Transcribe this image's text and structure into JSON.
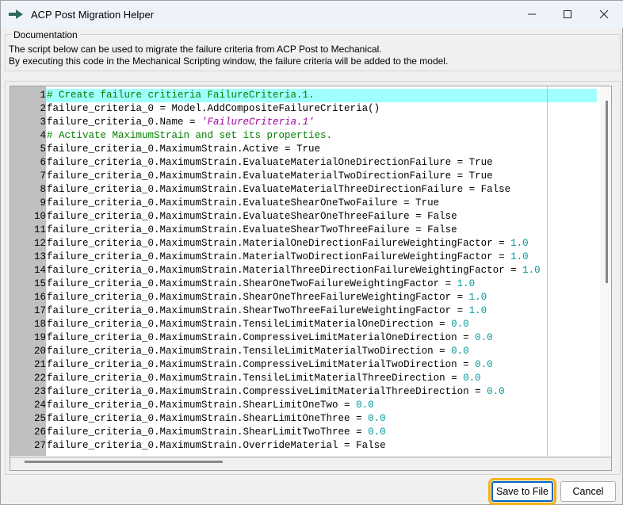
{
  "window": {
    "title": "ACP Post Migration Helper",
    "icon": "arrow-right-icon",
    "controls": [
      "minimize",
      "maximize",
      "close"
    ]
  },
  "documentation": {
    "label": "Documentation",
    "lines": [
      "The script below can be used to migrate the failure criteria from ACP Post to Mechanical.",
      "By executing this code in the Mechanical Scripting window, the failure criteria will be added to the model."
    ]
  },
  "editor": {
    "highlight_color": "#a0ffff",
    "current_line": 1,
    "lines": [
      [
        [
          "c",
          "# Create failure critieria FailureCriteria.1."
        ]
      ],
      [
        [
          "p",
          "failure_criteria_0 = Model.AddCompositeFailureCriteria()"
        ]
      ],
      [
        [
          "p",
          "failure_criteria_0.Name = "
        ],
        [
          "s",
          "'FailureCriteria.1'"
        ]
      ],
      [
        [
          "c",
          "# Activate MaximumStrain and set its properties."
        ]
      ],
      [
        [
          "p",
          "failure_criteria_0.MaximumStrain.Active = True"
        ]
      ],
      [
        [
          "p",
          "failure_criteria_0.MaximumStrain.EvaluateMaterialOneDirectionFailure = True"
        ]
      ],
      [
        [
          "p",
          "failure_criteria_0.MaximumStrain.EvaluateMaterialTwoDirectionFailure = True"
        ]
      ],
      [
        [
          "p",
          "failure_criteria_0.MaximumStrain.EvaluateMaterialThreeDirectionFailure = False"
        ]
      ],
      [
        [
          "p",
          "failure_criteria_0.MaximumStrain.EvaluateShearOneTwoFailure = True"
        ]
      ],
      [
        [
          "p",
          "failure_criteria_0.MaximumStrain.EvaluateShearOneThreeFailure = False"
        ]
      ],
      [
        [
          "p",
          "failure_criteria_0.MaximumStrain.EvaluateShearTwoThreeFailure = False"
        ]
      ],
      [
        [
          "p",
          "failure_criteria_0.MaximumStrain.MaterialOneDirectionFailureWeightingFactor = "
        ],
        [
          "n",
          "1.0"
        ]
      ],
      [
        [
          "p",
          "failure_criteria_0.MaximumStrain.MaterialTwoDirectionFailureWeightingFactor = "
        ],
        [
          "n",
          "1.0"
        ]
      ],
      [
        [
          "p",
          "failure_criteria_0.MaximumStrain.MaterialThreeDirectionFailureWeightingFactor = "
        ],
        [
          "n",
          "1.0"
        ]
      ],
      [
        [
          "p",
          "failure_criteria_0.MaximumStrain.ShearOneTwoFailureWeightingFactor = "
        ],
        [
          "n",
          "1.0"
        ]
      ],
      [
        [
          "p",
          "failure_criteria_0.MaximumStrain.ShearOneThreeFailureWeightingFactor = "
        ],
        [
          "n",
          "1.0"
        ]
      ],
      [
        [
          "p",
          "failure_criteria_0.MaximumStrain.ShearTwoThreeFailureWeightingFactor = "
        ],
        [
          "n",
          "1.0"
        ]
      ],
      [
        [
          "p",
          "failure_criteria_0.MaximumStrain.TensileLimitMaterialOneDirection = "
        ],
        [
          "n",
          "0.0"
        ]
      ],
      [
        [
          "p",
          "failure_criteria_0.MaximumStrain.CompressiveLimitMaterialOneDirection = "
        ],
        [
          "n",
          "0.0"
        ]
      ],
      [
        [
          "p",
          "failure_criteria_0.MaximumStrain.TensileLimitMaterialTwoDirection = "
        ],
        [
          "n",
          "0.0"
        ]
      ],
      [
        [
          "p",
          "failure_criteria_0.MaximumStrain.CompressiveLimitMaterialTwoDirection = "
        ],
        [
          "n",
          "0.0"
        ]
      ],
      [
        [
          "p",
          "failure_criteria_0.MaximumStrain.TensileLimitMaterialThreeDirection = "
        ],
        [
          "n",
          "0.0"
        ]
      ],
      [
        [
          "p",
          "failure_criteria_0.MaximumStrain.CompressiveLimitMaterialThreeDirection = "
        ],
        [
          "n",
          "0.0"
        ]
      ],
      [
        [
          "p",
          "failure_criteria_0.MaximumStrain.ShearLimitOneTwo = "
        ],
        [
          "n",
          "0.0"
        ]
      ],
      [
        [
          "p",
          "failure_criteria_0.MaximumStrain.ShearLimitOneThree = "
        ],
        [
          "n",
          "0.0"
        ]
      ],
      [
        [
          "p",
          "failure_criteria_0.MaximumStrain.ShearLimitTwoThree = "
        ],
        [
          "n",
          "0.0"
        ]
      ],
      [
        [
          "p",
          "failure_criteria_0.MaximumStrain.OverrideMaterial = False"
        ]
      ]
    ]
  },
  "buttons": {
    "save": "Save to File",
    "cancel": "Cancel",
    "focus_color": "#f5b119"
  }
}
